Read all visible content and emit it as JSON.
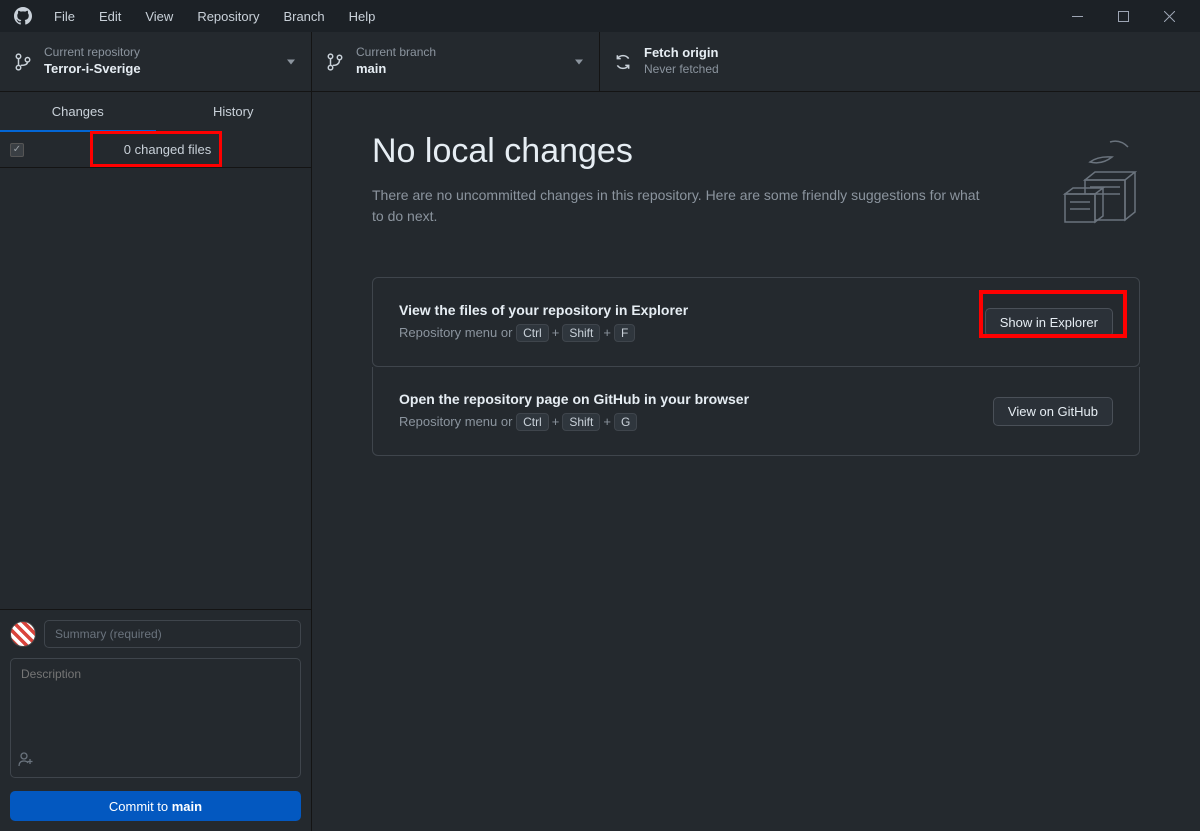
{
  "menu": [
    "File",
    "Edit",
    "View",
    "Repository",
    "Branch",
    "Help"
  ],
  "toolbar": {
    "repo": {
      "label": "Current repository",
      "value": "Terror-i-Sverige"
    },
    "branch": {
      "label": "Current branch",
      "value": "main"
    },
    "fetch": {
      "label": "Fetch origin",
      "value": "Never fetched"
    }
  },
  "tabs": {
    "changes": "Changes",
    "history": "History"
  },
  "changes_header": "0 changed files",
  "commit": {
    "summary_placeholder": "Summary (required)",
    "desc_placeholder": "Description",
    "button_prefix": "Commit to ",
    "button_branch": "main"
  },
  "main": {
    "title": "No local changes",
    "subtitle": "There are no uncommitted changes in this repository. Here are some friendly suggestions for what to do next.",
    "cards": [
      {
        "title": "View the files of your repository in Explorer",
        "sub_prefix": "Repository menu or ",
        "keys": [
          "Ctrl",
          "Shift",
          "F"
        ],
        "button": "Show in Explorer"
      },
      {
        "title": "Open the repository page on GitHub in your browser",
        "sub_prefix": "Repository menu or ",
        "keys": [
          "Ctrl",
          "Shift",
          "G"
        ],
        "button": "View on GitHub"
      }
    ]
  },
  "highlights": {
    "rb1": true,
    "rb2": true
  }
}
